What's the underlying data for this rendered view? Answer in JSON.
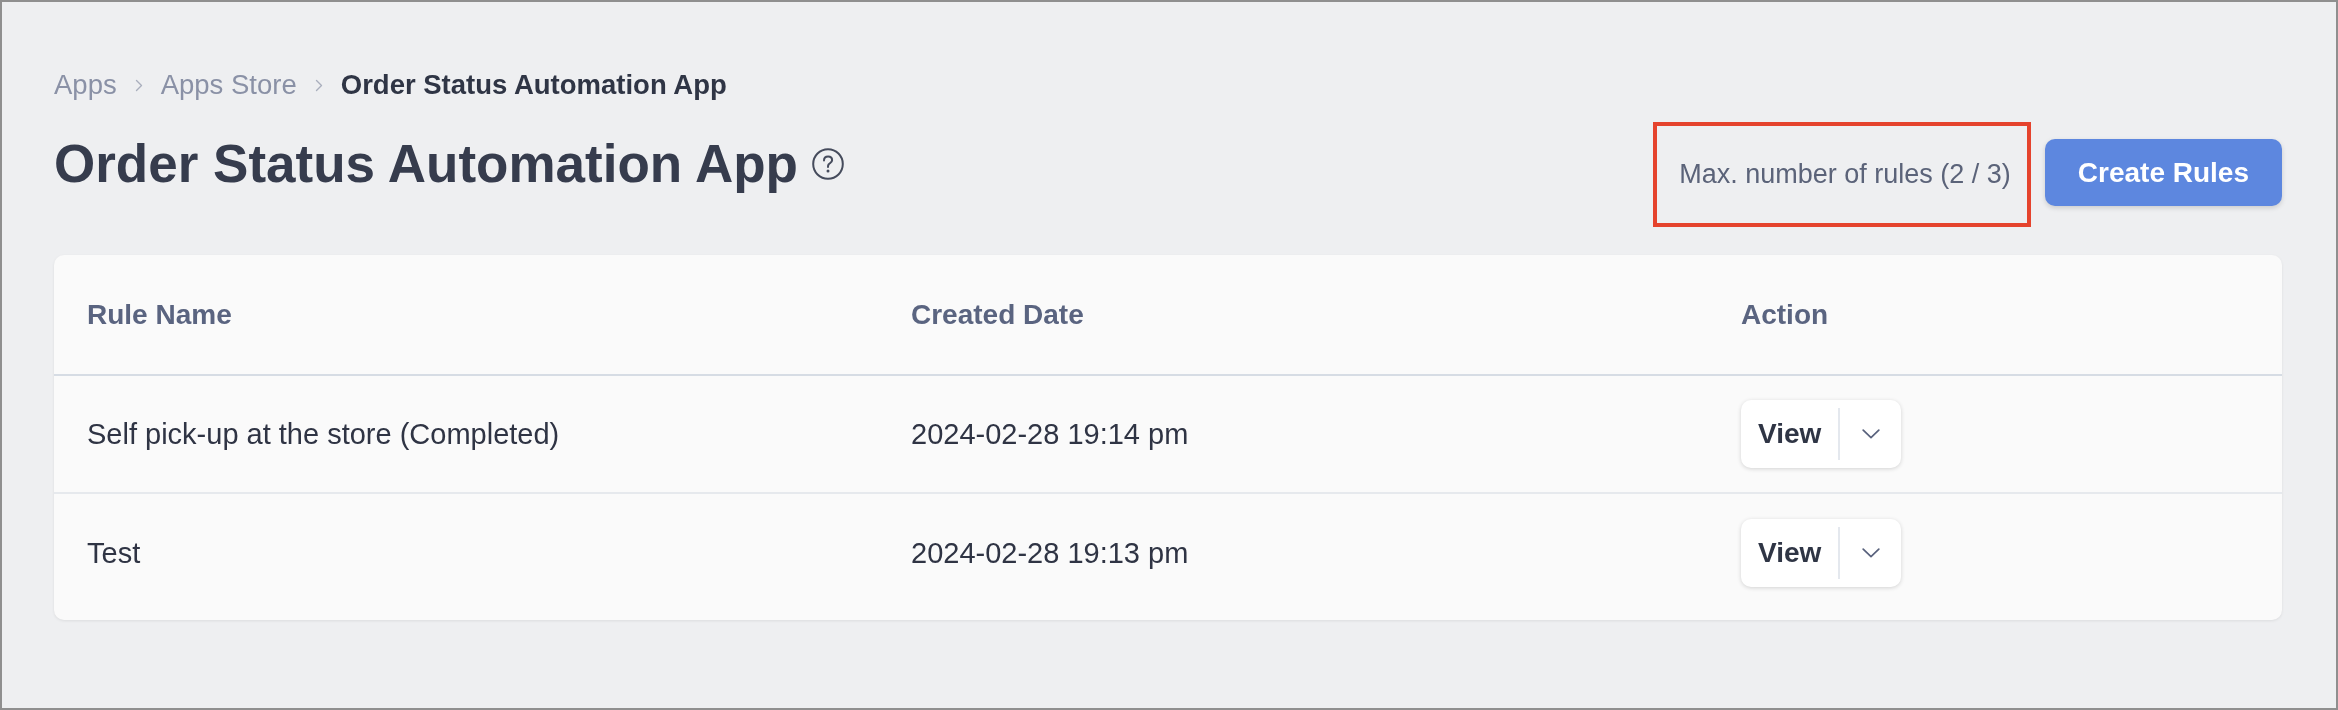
{
  "breadcrumb": [
    {
      "label": "Apps",
      "current": false
    },
    {
      "label": "Apps Store",
      "current": false
    },
    {
      "label": "Order Status Automation App",
      "current": true
    }
  ],
  "header": {
    "title": "Order Status Automation App",
    "rules_limit": {
      "text": "Max. number of rules (2 / 3)",
      "highlighted": true
    },
    "create_button": "Create Rules"
  },
  "table": {
    "columns": [
      "Rule Name",
      "Created Date",
      "Action"
    ],
    "rows": [
      {
        "rule_name": "Self pick-up at the store (Completed)",
        "created_date": "2024-02-28 19:14 pm",
        "action": "View"
      },
      {
        "rule_name": "Test",
        "created_date": "2024-02-28 19:13 pm",
        "action": "View"
      }
    ]
  }
}
